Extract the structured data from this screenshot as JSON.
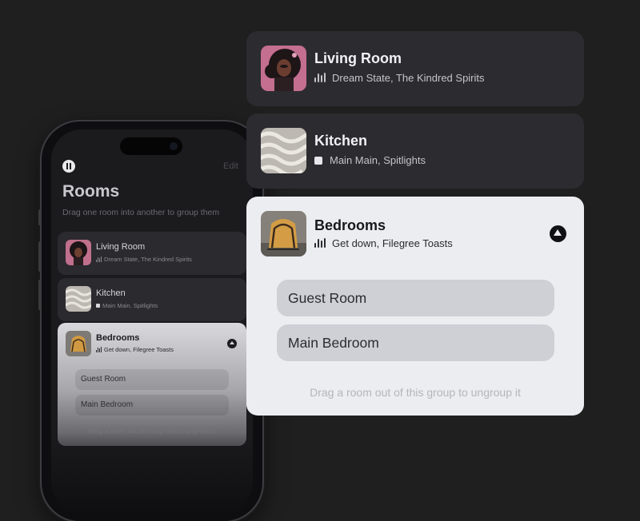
{
  "phone": {
    "title": "Rooms",
    "edit_label": "Edit",
    "subtitle": "Drag one room into another to group them",
    "rooms": [
      {
        "name": "Living Room",
        "now_playing": "Dream State, The Kindred Spirits"
      },
      {
        "name": "Kitchen",
        "now_playing": "Main Main, Spitlights"
      }
    ],
    "group": {
      "name": "Bedrooms",
      "now_playing": "Get down, Filegree Toasts",
      "members": [
        "Guest Room",
        "Main Bedroom"
      ],
      "hint": "Drag a room out of this group to ungroup it"
    }
  },
  "cards": [
    {
      "name": "Living Room",
      "now_playing": "Dream State, The Kindred Spirits",
      "status_icon": "playing-bars-icon"
    },
    {
      "name": "Kitchen",
      "now_playing": "Main Main, Spitlights",
      "status_icon": "stopped-square-icon"
    }
  ],
  "group": {
    "name": "Bedrooms",
    "now_playing": "Get down, Filegree Toasts",
    "status_icon": "playing-bars-icon",
    "collapse_icon": "chevron-up-icon",
    "members": [
      "Guest Room",
      "Main Bedroom"
    ],
    "hint": "Drag a room out of this group to ungroup it"
  },
  "colors": {
    "background": "#201f1f",
    "card_dark": "#2c2b30",
    "card_light": "#ecedf0",
    "member_pill": "#cfd0d6"
  }
}
